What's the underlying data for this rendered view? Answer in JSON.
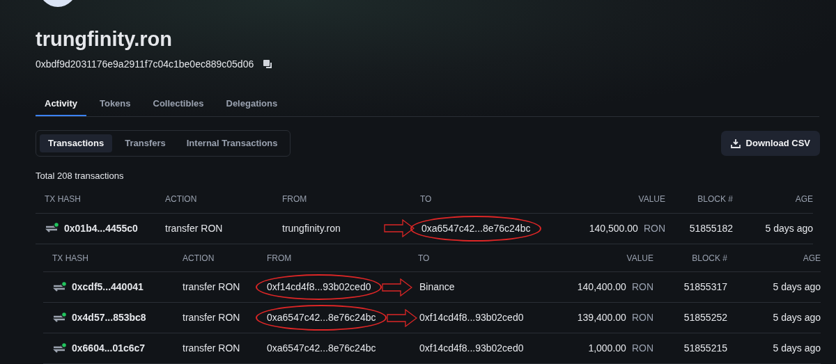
{
  "profile": {
    "name": "trungfinity.ron",
    "address": "0xbdf9d2031176e9a2911f7c04c1be0ec889c05d06"
  },
  "tabs": [
    {
      "label": "Activity",
      "selected": true
    },
    {
      "label": "Tokens",
      "selected": false
    },
    {
      "label": "Collectibles",
      "selected": false
    },
    {
      "label": "Delegations",
      "selected": false
    }
  ],
  "subtabs": [
    {
      "label": "Transactions",
      "selected": true
    },
    {
      "label": "Transfers",
      "selected": false
    },
    {
      "label": "Internal Transactions",
      "selected": false
    }
  ],
  "download_button": "Download CSV",
  "total": "Total 208 transactions",
  "tables": [
    {
      "columns": [
        "TX HASH",
        "ACTION",
        "FROM",
        "TO",
        "VALUE",
        "BLOCK #",
        "AGE"
      ],
      "rows": [
        {
          "hash": "0x01b4...4455c0",
          "action": "transfer RON",
          "from": "trungfinity.ron",
          "from_circled": false,
          "arrow": true,
          "to": "0xa6547c42...8e76c24bc",
          "to_circled": true,
          "value": "140,500.00",
          "unit": "RON",
          "block": "51855182",
          "age": "5 days ago"
        }
      ]
    },
    {
      "columns": [
        "TX HASH",
        "ACTION",
        "FROM",
        "TO",
        "VALUE",
        "BLOCK #",
        "AGE"
      ],
      "rows": [
        {
          "hash": "0xcdf5...440041",
          "action": "transfer RON",
          "from": "0xf14cd4f8...93b02ced0",
          "from_circled": true,
          "arrow": true,
          "to": "Binance",
          "to_circled": false,
          "value": "140,400.00",
          "unit": "RON",
          "block": "51855317",
          "age": "5 days ago"
        },
        {
          "hash": "0x4d57...853bc8",
          "action": "transfer RON",
          "from": "0xa6547c42...8e76c24bc",
          "from_circled": true,
          "arrow": true,
          "to": "0xf14cd4f8...93b02ced0",
          "to_circled": false,
          "value": "139,400.00",
          "unit": "RON",
          "block": "51855252",
          "age": "5 days ago"
        },
        {
          "hash": "0x6604...01c6c7",
          "action": "transfer RON",
          "from": "0xa6547c42...8e76c24bc",
          "from_circled": false,
          "arrow": false,
          "to": "0xf14cd4f8...93b02ced0",
          "to_circled": false,
          "value": "1,000.00",
          "unit": "RON",
          "block": "51855215",
          "age": "5 days ago"
        }
      ]
    }
  ]
}
